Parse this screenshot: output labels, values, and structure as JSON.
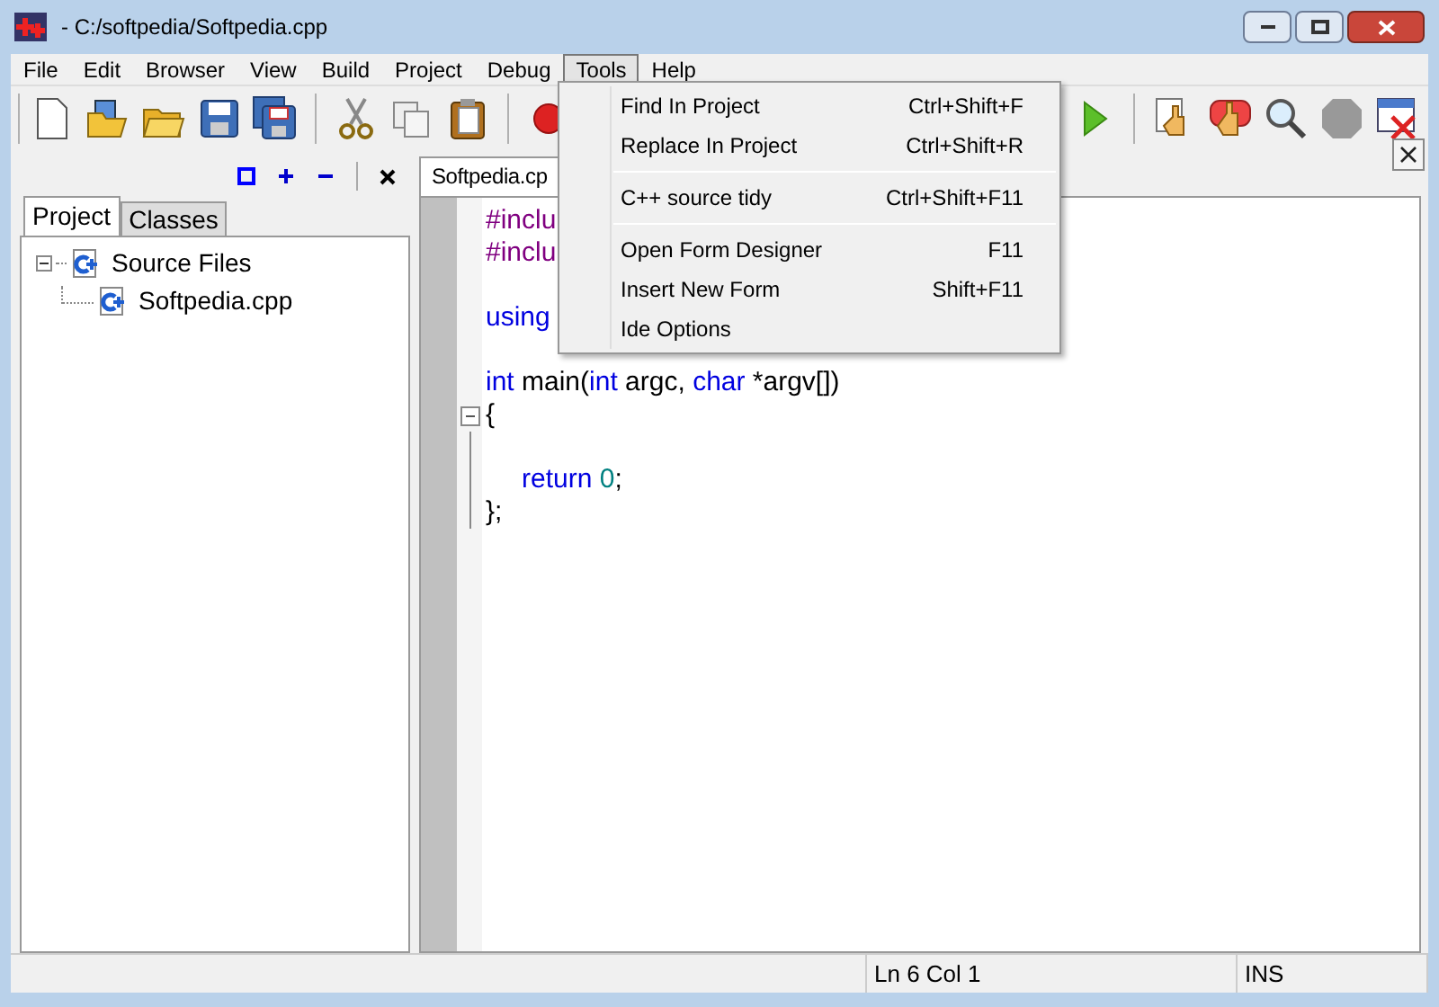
{
  "window": {
    "title": "- C:/softpedia/Softpedia.cpp"
  },
  "menubar": [
    {
      "label": "File",
      "selected": false
    },
    {
      "label": "Edit",
      "selected": false
    },
    {
      "label": "Browser",
      "selected": false
    },
    {
      "label": "View",
      "selected": false
    },
    {
      "label": "Build",
      "selected": false
    },
    {
      "label": "Project",
      "selected": false
    },
    {
      "label": "Debug",
      "selected": false
    },
    {
      "label": "Tools",
      "selected": true
    },
    {
      "label": "Help",
      "selected": false
    }
  ],
  "toolbar": [
    {
      "kind": "new"
    },
    {
      "kind": "open-project"
    },
    {
      "kind": "open"
    },
    {
      "kind": "save"
    },
    {
      "kind": "save-all"
    },
    {
      "kind": "sep"
    },
    {
      "kind": "cut"
    },
    {
      "kind": "copy"
    },
    {
      "kind": "paste"
    },
    {
      "kind": "sep"
    },
    {
      "kind": "record"
    },
    {
      "kind": "gap"
    },
    {
      "kind": "run"
    },
    {
      "kind": "sep"
    },
    {
      "kind": "doc-hand"
    },
    {
      "kind": "hand"
    },
    {
      "kind": "find"
    },
    {
      "kind": "stop"
    },
    {
      "kind": "close-window"
    }
  ],
  "tools_menu": [
    {
      "kind": "item",
      "label": "Find In Project",
      "shortcut": "Ctrl+Shift+F"
    },
    {
      "kind": "item",
      "label": "Replace In Project",
      "shortcut": "Ctrl+Shift+R"
    },
    {
      "kind": "separator"
    },
    {
      "kind": "item",
      "label": "C++ source tidy",
      "shortcut": "Ctrl+Shift+F11"
    },
    {
      "kind": "separator"
    },
    {
      "kind": "item",
      "label": "Open Form Designer",
      "shortcut": "F11"
    },
    {
      "kind": "item",
      "label": "Insert New Form",
      "shortcut": "Shift+F11"
    },
    {
      "kind": "item",
      "label": "Ide Options"
    }
  ],
  "panel_tabs": [
    {
      "label": "Project",
      "selected": true
    },
    {
      "label": "Classes",
      "selected": false
    }
  ],
  "tree": [
    {
      "label": "Source Files",
      "expanded": true,
      "children": [
        {
          "label": "Softpedia.cpp"
        }
      ]
    }
  ],
  "editor_tab": "Softpedia.cp",
  "code": [
    {
      "kind": "code",
      "tokens": [
        {
          "kind": "preproc",
          "text": "#inclu"
        }
      ]
    },
    {
      "kind": "code",
      "tokens": [
        {
          "kind": "preproc",
          "text": "#inclu"
        }
      ]
    },
    {
      "kind": "blank"
    },
    {
      "kind": "code",
      "tokens": [
        {
          "kind": "keyword",
          "text": "using"
        }
      ]
    },
    {
      "kind": "blank"
    },
    {
      "kind": "code",
      "tokens": [
        {
          "kind": "keyword",
          "text": "int"
        },
        {
          "kind": "plain",
          "text": " main("
        },
        {
          "kind": "keyword",
          "text": "int"
        },
        {
          "kind": "plain",
          "text": " argc, "
        },
        {
          "kind": "keyword",
          "text": "char"
        },
        {
          "kind": "plain",
          "text": " *argv[])"
        }
      ]
    },
    {
      "kind": "code",
      "fold": true,
      "tokens": [
        {
          "kind": "plain",
          "text": "{"
        }
      ]
    },
    {
      "kind": "blank"
    },
    {
      "kind": "indented",
      "tokens": [
        {
          "kind": "keyword",
          "text": "return "
        },
        {
          "kind": "number",
          "text": "0"
        },
        {
          "kind": "plain",
          "text": ";"
        }
      ]
    },
    {
      "kind": "code",
      "tokens": [
        {
          "kind": "plain",
          "text": "};"
        }
      ]
    }
  ],
  "status_bar": [
    "Ln 6   Col 1",
    "INS"
  ]
}
